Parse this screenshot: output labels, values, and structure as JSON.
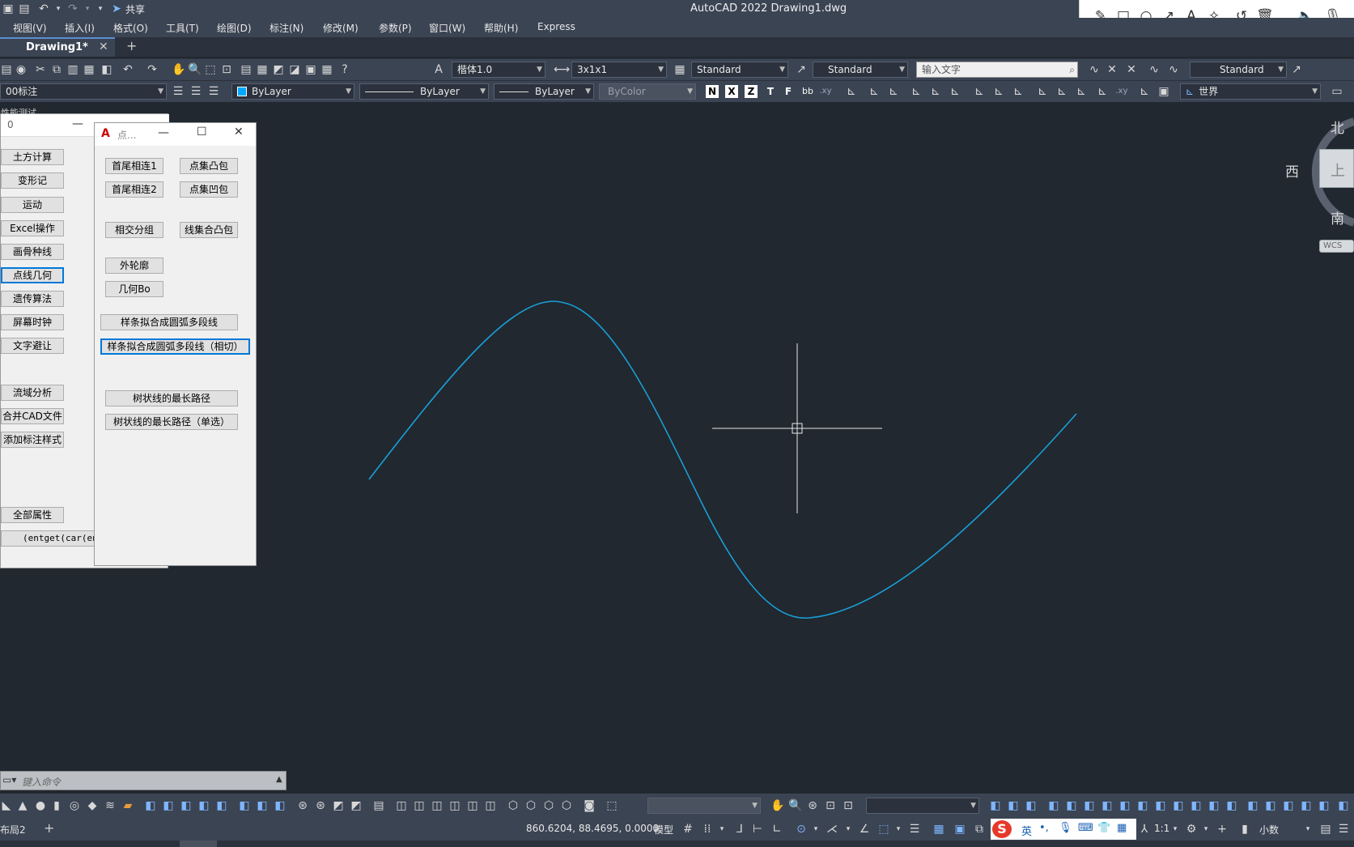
{
  "app": {
    "title": "AutoCAD 2022    Drawing1.dwg",
    "share_label": "共享"
  },
  "menu": [
    "视图(V)",
    "插入(I)",
    "格式(O)",
    "工具(T)",
    "绘图(D)",
    "标注(N)",
    "修改(M)",
    "参数(P)",
    "窗口(W)",
    "帮助(H)",
    "Express"
  ],
  "tabs": [
    {
      "label": "Drawing1*"
    }
  ],
  "toolbar1": {
    "text_style": "楷体1.0",
    "dim_style": "3x1x1",
    "table_style": "Standard",
    "mleader_style": "Standard",
    "search_placeholder": "输入文字",
    "visual_style": "Standard"
  },
  "toolbar2": {
    "layer": "00标注",
    "color": "ByLayer",
    "color_swatch": "#00a8ff",
    "linetype": "ByLayer",
    "lineweight": "ByLayer",
    "plotstyle": "ByColor",
    "ucs": "世界"
  },
  "palette_left": {
    "title": "0",
    "header": "性能测试",
    "buttons": [
      "土方计算",
      "变形记",
      "运动",
      "Excel操作",
      "画骨种线",
      "点线几何",
      "遗传算法",
      "屏幕时钟",
      "文字避让",
      "流域分析",
      "合并CAD文件",
      "添加标注样式",
      "全部属性"
    ],
    "footer_code": "(entget(car(ent"
  },
  "palette_point": {
    "title": "点...",
    "buttons": [
      "首尾相连1",
      "点集凸包",
      "首尾相连2",
      "点集凹包",
      "相交分组",
      "线集合凸包",
      "外轮廓",
      "几何Bo",
      "样条拟合成圆弧多段线",
      "样条拟合成圆弧多段线（相切）",
      "树状线的最长路径",
      "树状线的最长路径（单选）"
    ]
  },
  "viewcube": {
    "north": "北",
    "south": "南",
    "west": "西",
    "top": "上",
    "wcs": "WCS"
  },
  "command": {
    "placeholder": "键入命令"
  },
  "layout": {
    "tab": "布局2"
  },
  "status": {
    "coords": "860.6204, 88.4695, 0.0000",
    "model": "模型",
    "scale": "1:1",
    "units": "小数",
    "ime": "英"
  },
  "colors": {
    "canvas": "#212830",
    "curve": "#1a9fd6",
    "crosshair": "#e6e6e6"
  }
}
